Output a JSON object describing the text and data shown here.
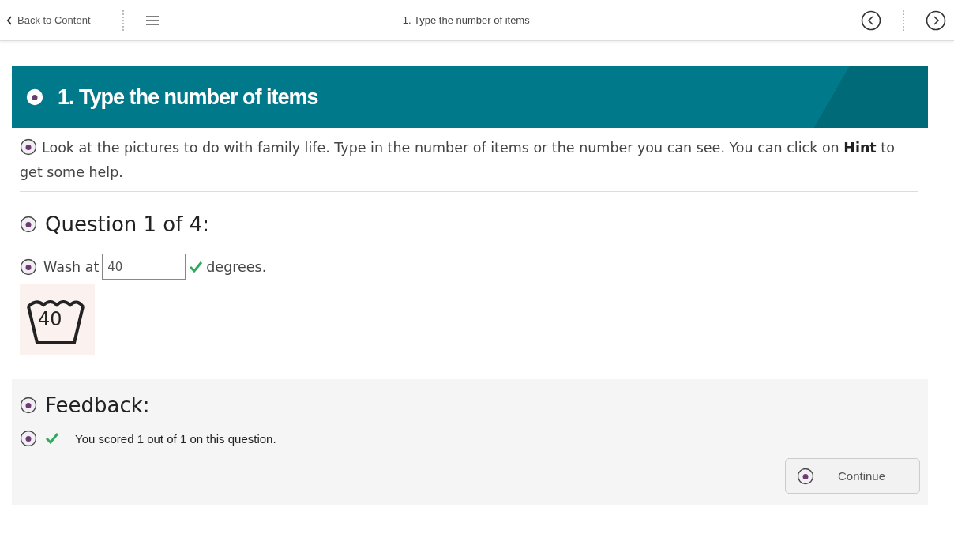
{
  "topbar": {
    "back": "Back to Content",
    "title": "1. Type the number of items"
  },
  "header": {
    "title": "1. Type the number of items"
  },
  "instructions": "Look at the pictures to do with family life. Type in the number of items or the number you can see. You can click on **Hint** to get some help.",
  "question": {
    "heading": "Question 1 of 4:",
    "before": "Wash at",
    "answer": "40",
    "correct": true,
    "after": "degrees.",
    "symbol_label": "40"
  },
  "feedback": {
    "heading": "Feedback:",
    "message": "You scored 1 out of 1 on this question.",
    "correct": true,
    "button": "Continue"
  }
}
